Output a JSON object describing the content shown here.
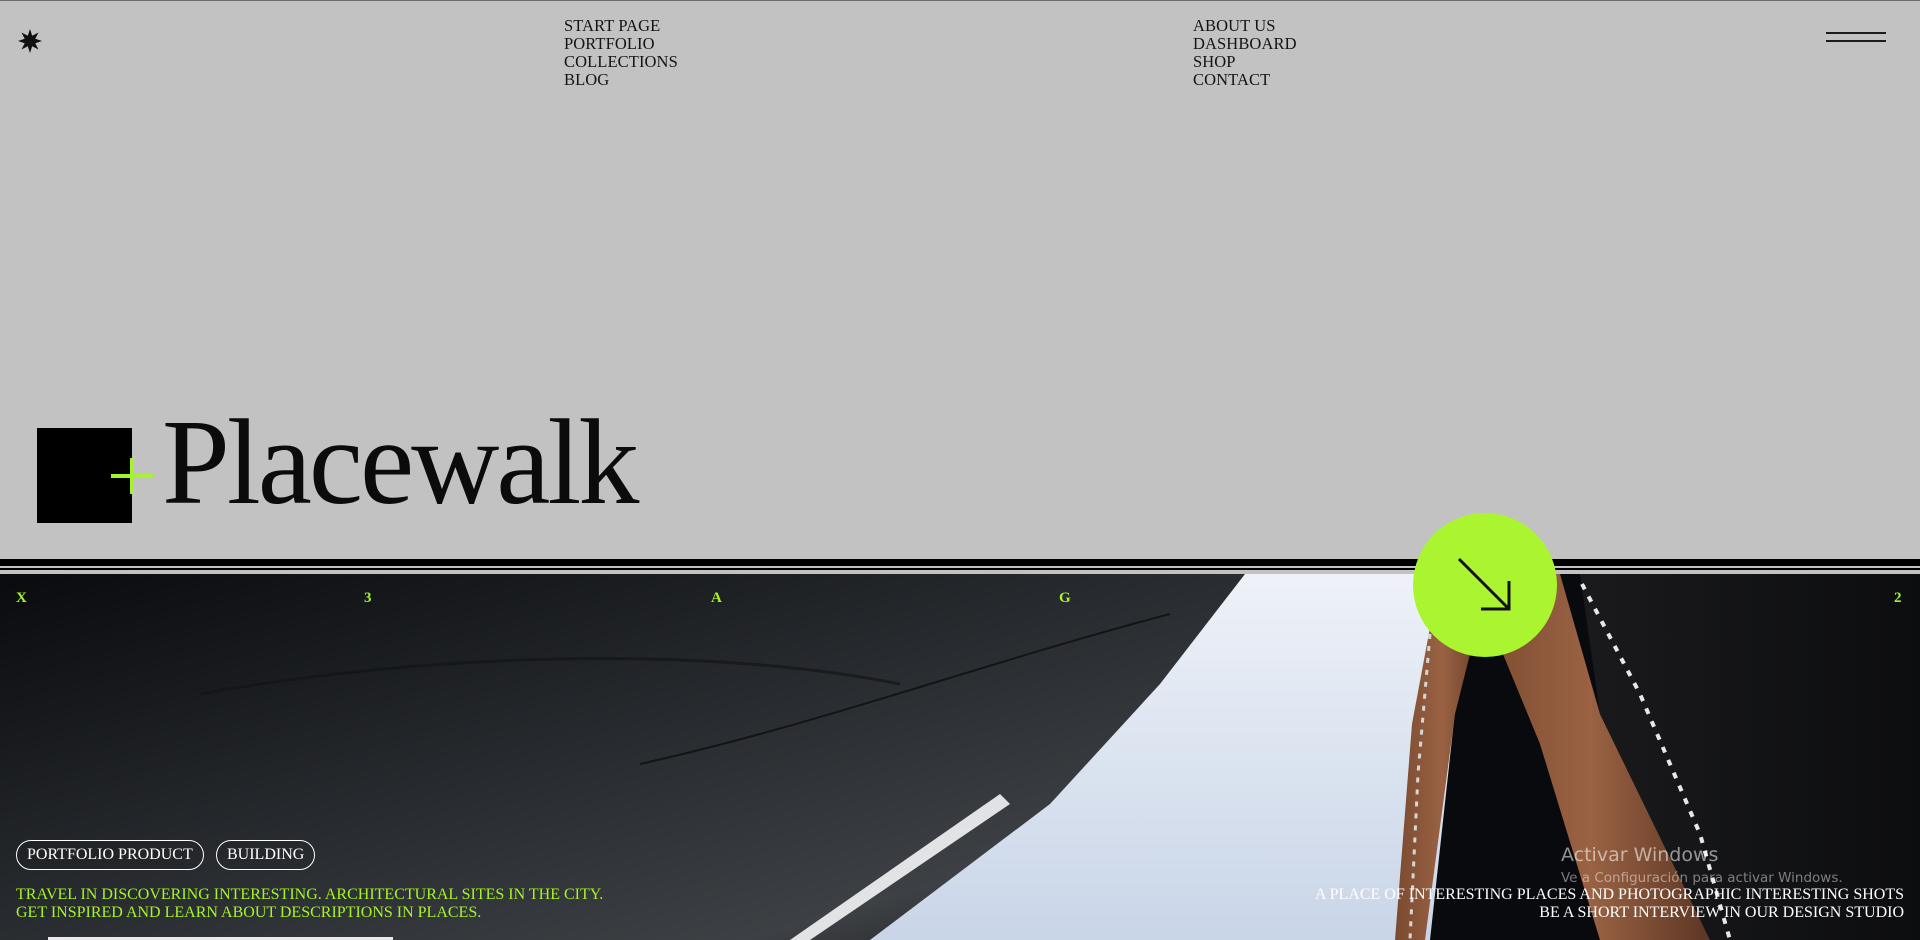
{
  "nav": {
    "left": [
      {
        "label": "START PAGE"
      },
      {
        "label": "PORTFOLIO"
      },
      {
        "label": "COLLECTIONS"
      },
      {
        "label": "BLOG"
      }
    ],
    "right": [
      {
        "label": "ABOUT US"
      },
      {
        "label": "DASHBOARD"
      },
      {
        "label": "SHOP"
      },
      {
        "label": "CONTACT"
      }
    ]
  },
  "brand": {
    "title": "Placewalk",
    "accent_color": "#a6f527"
  },
  "hero": {
    "markers": [
      "X",
      "3",
      "A",
      "G",
      "2"
    ],
    "tags": [
      "PORTFOLIO PRODUCT",
      "BUILDING"
    ],
    "description_left": [
      "TRAVEL IN DISCOVERING INTERESTING. ARCHITECTURAL SITES IN THE CITY.",
      "GET INSPIRED AND LEARN ABOUT DESCRIPTIONS IN PLACES."
    ],
    "description_right": [
      "A PLACE OF INTERESTING PLACES AND PHOTOGRAPHIC INTERESTING SHOTS",
      "BE A SHORT INTERVIEW IN OUR DESIGN STUDIO"
    ]
  },
  "windows_watermark": {
    "title": "Activar Windows",
    "subtitle": "Ve a Configuración para activar Windows."
  },
  "icons": {
    "logo": "star-icon",
    "menu": "hamburger-icon",
    "arrow": "arrow-down-right-icon"
  }
}
